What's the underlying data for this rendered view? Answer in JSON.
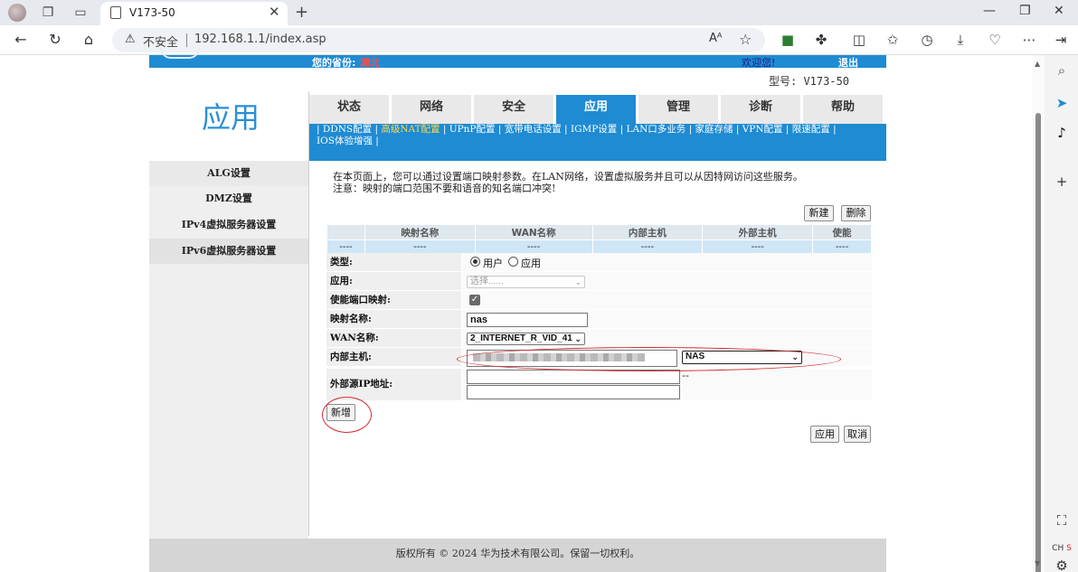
{
  "browser": {
    "tab_title": "V173-50",
    "insecure_label": "不安全",
    "url": "192.168.1.1/index.asp",
    "reader_label": "Aᴬ"
  },
  "header": {
    "province_label": "您的省份:",
    "province_value": "湖北",
    "welcome": "欢迎您!",
    "logout": "退出",
    "model": "型号: V173-50"
  },
  "page_title": "应用",
  "main_tabs": [
    {
      "label": "状态"
    },
    {
      "label": "网络"
    },
    {
      "label": "安全"
    },
    {
      "label": "应用"
    },
    {
      "label": "管理"
    },
    {
      "label": "诊断"
    },
    {
      "label": "帮助"
    }
  ],
  "sub_nav": {
    "items": [
      "DDNS配置",
      "高级NAT配置",
      "UPnP配置",
      "宽带电话设置",
      "IGMP设置",
      "LAN口多业务",
      "家庭存储",
      "VPN配置",
      "限速配置",
      "IOS体验增强"
    ],
    "current": "高级NAT配置"
  },
  "left_nav": [
    {
      "label": "ALG设置"
    },
    {
      "label": "DMZ设置"
    },
    {
      "label": "IPv4虚拟服务器设置"
    },
    {
      "label": "IPv6虚拟服务器设置"
    }
  ],
  "description": {
    "line1": "在本页面上，您可以通过设置端口映射参数。在LAN网络，设置虚拟服务并且可以从因特网访问这些服务。",
    "line2": "注意：映射的端口范围不要和语音的知名端口冲突!"
  },
  "buttons": {
    "new": "新建",
    "delete": "删除",
    "add": "新增",
    "apply": "应用",
    "cancel": "取消"
  },
  "table": {
    "headers": [
      "",
      "映射名称",
      "WAN名称",
      "内部主机",
      "外部主机",
      "使能"
    ],
    "row": [
      "----",
      "----",
      "----",
      "----",
      "----",
      "----"
    ]
  },
  "form": {
    "type_label": "类型:",
    "type_options": [
      "用户",
      "应用"
    ],
    "type_selected": "用户",
    "app_label": "应用:",
    "app_placeholder": "选择......",
    "enable_label": "使能端口映射:",
    "enable_checked": true,
    "name_label": "映射名称:",
    "name_value": "nas",
    "wan_label": "WAN名称:",
    "wan_value": "2_INTERNET_R_VID_41",
    "host_label": "内部主机:",
    "host_select": "NAS",
    "ext_ip_label": "外部源IP地址:",
    "ext_ip_sep": "--"
  },
  "footer": "版权所有 © 2024 华为技术有限公司。保留一切权利。",
  "colors": {
    "accent": "#1f8bd2",
    "annotation": "#d62a2a",
    "province": "#ff4a4a"
  }
}
